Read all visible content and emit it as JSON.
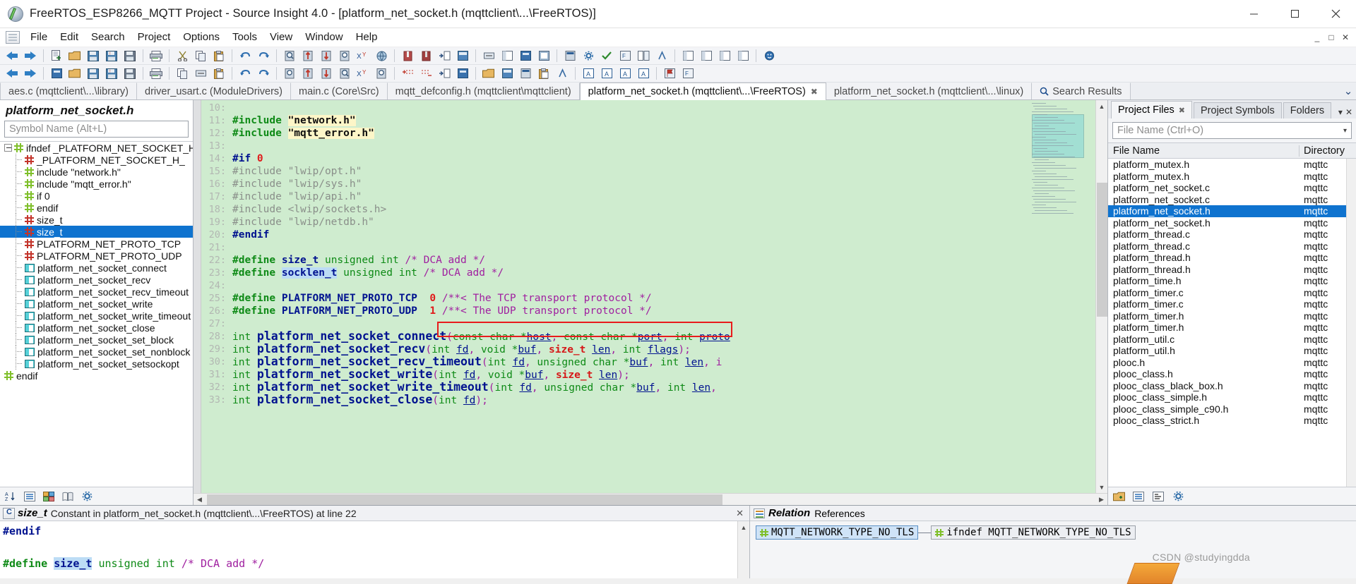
{
  "window": {
    "title": "FreeRTOS_ESP8266_MQTT Project - Source Insight 4.0 - [platform_net_socket.h (mqttclient\\...\\FreeRTOS)]",
    "app_icon": "source-insight-icon",
    "minimize": "minimize-icon",
    "maximize": "maximize-icon",
    "close": "close-icon"
  },
  "menu": {
    "items": [
      "File",
      "Edit",
      "Search",
      "Project",
      "Options",
      "Tools",
      "View",
      "Window",
      "Help"
    ],
    "doc_icon": "document-icon",
    "mdi_controls": [
      "_",
      "□",
      "✕"
    ]
  },
  "doc_tabs": [
    {
      "label": "aes.c (mqttclient\\...\\library)",
      "active": false,
      "closable": false,
      "icon": ""
    },
    {
      "label": "driver_usart.c (ModuleDrivers)",
      "active": false,
      "closable": false,
      "icon": ""
    },
    {
      "label": "main.c (Core\\Src)",
      "active": false,
      "closable": false,
      "icon": ""
    },
    {
      "label": "mqtt_defconfig.h (mqttclient\\mqttclient)",
      "active": false,
      "closable": false,
      "icon": ""
    },
    {
      "label": "platform_net_socket.h (mqttclient\\...\\FreeRTOS)",
      "active": true,
      "closable": true,
      "icon": ""
    },
    {
      "label": "platform_net_socket.h (mqttclient\\...\\linux)",
      "active": false,
      "closable": false,
      "icon": ""
    },
    {
      "label": "Search Results",
      "active": false,
      "closable": false,
      "icon": "search-icon"
    }
  ],
  "symbol_panel": {
    "title": "platform_net_socket.h",
    "search_placeholder": "Symbol Name (Alt+L)",
    "search_value": "",
    "tree": [
      {
        "label": "ifndef _PLATFORM_NET_SOCKET_H_",
        "icon": "hash-green",
        "depth": 0,
        "root": true,
        "selected": false
      },
      {
        "label": "_PLATFORM_NET_SOCKET_H_",
        "icon": "hash-red",
        "depth": 1,
        "selected": false
      },
      {
        "label": "include \"network.h\"",
        "icon": "hash-green",
        "depth": 1,
        "selected": false
      },
      {
        "label": "include \"mqtt_error.h\"",
        "icon": "hash-green",
        "depth": 1,
        "selected": false
      },
      {
        "label": "if 0",
        "icon": "hash-green",
        "depth": 1,
        "selected": false
      },
      {
        "label": "endif",
        "icon": "hash-green",
        "depth": 1,
        "selected": false
      },
      {
        "label": "size_t",
        "icon": "hash-red",
        "depth": 1,
        "selected": false
      },
      {
        "label": "size_t",
        "icon": "hash-red",
        "depth": 1,
        "selected": true
      },
      {
        "label": "PLATFORM_NET_PROTO_TCP",
        "icon": "hash-red",
        "depth": 1,
        "selected": false
      },
      {
        "label": "PLATFORM_NET_PROTO_UDP",
        "icon": "hash-red",
        "depth": 1,
        "selected": false
      },
      {
        "label": "platform_net_socket_connect",
        "icon": "function",
        "depth": 1,
        "selected": false
      },
      {
        "label": "platform_net_socket_recv",
        "icon": "function",
        "depth": 1,
        "selected": false
      },
      {
        "label": "platform_net_socket_recv_timeout",
        "icon": "function",
        "depth": 1,
        "selected": false
      },
      {
        "label": "platform_net_socket_write",
        "icon": "function",
        "depth": 1,
        "selected": false
      },
      {
        "label": "platform_net_socket_write_timeout",
        "icon": "function",
        "depth": 1,
        "selected": false
      },
      {
        "label": "platform_net_socket_close",
        "icon": "function",
        "depth": 1,
        "selected": false
      },
      {
        "label": "platform_net_socket_set_block",
        "icon": "function",
        "depth": 1,
        "selected": false
      },
      {
        "label": "platform_net_socket_set_nonblock",
        "icon": "function",
        "depth": 1,
        "selected": false
      },
      {
        "label": "platform_net_socket_setsockopt",
        "icon": "function",
        "depth": 1,
        "selected": false
      },
      {
        "label": "endif",
        "icon": "hash-green",
        "depth": 0,
        "selected": false
      }
    ],
    "bottom_icons": [
      "sort-az-icon",
      "list-icon",
      "group-icon",
      "book-icon",
      "settings-icon"
    ]
  },
  "editor": {
    "highlight_box_line": 23,
    "lines": [
      {
        "n": "10",
        "parts": []
      },
      {
        "n": "11",
        "parts": [
          {
            "t": "#include ",
            "c": "k-pre"
          },
          {
            "t": "\"network.h\"",
            "c": "k-str"
          }
        ]
      },
      {
        "n": "12",
        "parts": [
          {
            "t": "#include ",
            "c": "k-pre"
          },
          {
            "t": "\"mqtt_error.h\"",
            "c": "k-str"
          }
        ]
      },
      {
        "n": "13",
        "parts": []
      },
      {
        "n": "14",
        "parts": [
          {
            "t": "#if ",
            "c": "k-dir"
          },
          {
            "t": "0",
            "c": "k-num"
          }
        ]
      },
      {
        "n": "15",
        "parts": [
          {
            "t": "#include \"lwip/opt.h\"",
            "c": "k-grey"
          }
        ]
      },
      {
        "n": "16",
        "parts": [
          {
            "t": "#include \"lwip/sys.h\"",
            "c": "k-grey"
          }
        ]
      },
      {
        "n": "17",
        "parts": [
          {
            "t": "#include \"lwip/api.h\"",
            "c": "k-grey"
          }
        ]
      },
      {
        "n": "18",
        "parts": [
          {
            "t": "#include <lwip/sockets.h>",
            "c": "k-grey"
          }
        ]
      },
      {
        "n": "19",
        "parts": [
          {
            "t": "#include \"lwip/netdb.h\"",
            "c": "k-grey"
          }
        ]
      },
      {
        "n": "20",
        "parts": [
          {
            "t": "#endif",
            "c": "k-dir"
          }
        ]
      },
      {
        "n": "21",
        "parts": []
      },
      {
        "n": "22",
        "parts": [
          {
            "t": "#define ",
            "c": "k-pre"
          },
          {
            "t": "size_t",
            "c": "k-def"
          },
          {
            "t": " unsigned int ",
            "c": "k-int"
          },
          {
            "t": "/* DCA add */",
            "c": "k-cmt"
          }
        ]
      },
      {
        "n": "23",
        "parts": [
          {
            "t": "#define ",
            "c": "k-pre"
          },
          {
            "t": "socklen_t",
            "c": "k-def hl-sel"
          },
          {
            "t": " unsigned int ",
            "c": "k-int"
          },
          {
            "t": "/* DCA add */",
            "c": "k-cmt"
          }
        ]
      },
      {
        "n": "24",
        "parts": []
      },
      {
        "n": "25",
        "parts": [
          {
            "t": "#define ",
            "c": "k-pre"
          },
          {
            "t": "PLATFORM_NET_PROTO_TCP  ",
            "c": "k-def"
          },
          {
            "t": "0 ",
            "c": "k-num"
          },
          {
            "t": "/**< The TCP transport protocol */",
            "c": "k-cmt"
          }
        ]
      },
      {
        "n": "26",
        "parts": [
          {
            "t": "#define ",
            "c": "k-pre"
          },
          {
            "t": "PLATFORM_NET_PROTO_UDP  ",
            "c": "k-def"
          },
          {
            "t": "1 ",
            "c": "k-num"
          },
          {
            "t": "/**< The UDP transport protocol */",
            "c": "k-cmt"
          }
        ]
      },
      {
        "n": "27",
        "parts": []
      },
      {
        "n": "28",
        "parts": [
          {
            "t": "int ",
            "c": "k-type"
          },
          {
            "t": "platform_net_socket_connect",
            "c": "k-fn"
          },
          {
            "t": "(",
            "c": "k-paren"
          },
          {
            "t": "const char *",
            "c": "k-int"
          },
          {
            "t": "host",
            "c": "k-var"
          },
          {
            "t": ", ",
            "c": "k-paren"
          },
          {
            "t": "const char *",
            "c": "k-int"
          },
          {
            "t": "port",
            "c": "k-var"
          },
          {
            "t": ", ",
            "c": "k-paren"
          },
          {
            "t": "int ",
            "c": "k-int"
          },
          {
            "t": "proto",
            "c": "k-var"
          }
        ]
      },
      {
        "n": "29",
        "parts": [
          {
            "t": "int ",
            "c": "k-type"
          },
          {
            "t": "platform_net_socket_recv",
            "c": "k-fn"
          },
          {
            "t": "(",
            "c": "k-paren"
          },
          {
            "t": "int ",
            "c": "k-int"
          },
          {
            "t": "fd",
            "c": "k-var"
          },
          {
            "t": ", ",
            "c": "k-paren"
          },
          {
            "t": "void *",
            "c": "k-int"
          },
          {
            "t": "buf",
            "c": "k-var"
          },
          {
            "t": ", ",
            "c": "k-paren"
          },
          {
            "t": "size_t ",
            "c": "k-sizet"
          },
          {
            "t": "len",
            "c": "k-var"
          },
          {
            "t": ", ",
            "c": "k-paren"
          },
          {
            "t": "int ",
            "c": "k-int"
          },
          {
            "t": "flags",
            "c": "k-var"
          },
          {
            "t": ");",
            "c": "k-paren"
          }
        ]
      },
      {
        "n": "30",
        "parts": [
          {
            "t": "int ",
            "c": "k-type"
          },
          {
            "t": "platform_net_socket_recv_timeout",
            "c": "k-fn"
          },
          {
            "t": "(",
            "c": "k-paren"
          },
          {
            "t": "int ",
            "c": "k-int"
          },
          {
            "t": "fd",
            "c": "k-var"
          },
          {
            "t": ", ",
            "c": "k-paren"
          },
          {
            "t": "unsigned char *",
            "c": "k-int"
          },
          {
            "t": "buf",
            "c": "k-var"
          },
          {
            "t": ", ",
            "c": "k-paren"
          },
          {
            "t": "int ",
            "c": "k-int"
          },
          {
            "t": "len",
            "c": "k-var"
          },
          {
            "t": ", i",
            "c": "k-paren"
          }
        ]
      },
      {
        "n": "31",
        "parts": [
          {
            "t": "int ",
            "c": "k-type"
          },
          {
            "t": "platform_net_socket_write",
            "c": "k-fn"
          },
          {
            "t": "(",
            "c": "k-paren"
          },
          {
            "t": "int ",
            "c": "k-int"
          },
          {
            "t": "fd",
            "c": "k-var"
          },
          {
            "t": ", ",
            "c": "k-paren"
          },
          {
            "t": "void *",
            "c": "k-int"
          },
          {
            "t": "buf",
            "c": "k-var"
          },
          {
            "t": ", ",
            "c": "k-paren"
          },
          {
            "t": "size_t ",
            "c": "k-sizet"
          },
          {
            "t": "len",
            "c": "k-var"
          },
          {
            "t": ");",
            "c": "k-paren"
          }
        ]
      },
      {
        "n": "32",
        "parts": [
          {
            "t": "int ",
            "c": "k-type"
          },
          {
            "t": "platform_net_socket_write_timeout",
            "c": "k-fn"
          },
          {
            "t": "(",
            "c": "k-paren"
          },
          {
            "t": "int ",
            "c": "k-int"
          },
          {
            "t": "fd",
            "c": "k-var"
          },
          {
            "t": ", ",
            "c": "k-paren"
          },
          {
            "t": "unsigned char *",
            "c": "k-int"
          },
          {
            "t": "buf",
            "c": "k-var"
          },
          {
            "t": ", ",
            "c": "k-paren"
          },
          {
            "t": "int ",
            "c": "k-int"
          },
          {
            "t": "len",
            "c": "k-var"
          },
          {
            "t": ",",
            "c": "k-paren"
          }
        ]
      },
      {
        "n": "33",
        "parts": [
          {
            "t": "int ",
            "c": "k-type"
          },
          {
            "t": "platform_net_socket_close",
            "c": "k-fn"
          },
          {
            "t": "(",
            "c": "k-paren"
          },
          {
            "t": "int ",
            "c": "k-int"
          },
          {
            "t": "fd",
            "c": "k-var"
          },
          {
            "t": ");",
            "c": "k-paren"
          }
        ]
      }
    ]
  },
  "project_panel": {
    "tabs": [
      {
        "label": "Project Files",
        "active": true,
        "closable": true
      },
      {
        "label": "Project Symbols",
        "active": false,
        "closable": false
      },
      {
        "label": "Folders",
        "active": false,
        "closable": false
      }
    ],
    "tab_controls": [
      "chevron-down-icon",
      "close-icon"
    ],
    "search_placeholder": "File Name (Ctrl+O)",
    "search_value": "",
    "columns": [
      "File Name",
      "Directory"
    ],
    "rows": [
      {
        "name": "platform_mutex.h",
        "dir": "mqttc",
        "selected": false
      },
      {
        "name": "platform_mutex.h",
        "dir": "mqttc",
        "selected": false
      },
      {
        "name": "platform_net_socket.c",
        "dir": "mqttc",
        "selected": false
      },
      {
        "name": "platform_net_socket.c",
        "dir": "mqttc",
        "selected": false
      },
      {
        "name": "platform_net_socket.h",
        "dir": "mqttc",
        "selected": true
      },
      {
        "name": "platform_net_socket.h",
        "dir": "mqttc",
        "selected": false
      },
      {
        "name": "platform_thread.c",
        "dir": "mqttc",
        "selected": false
      },
      {
        "name": "platform_thread.c",
        "dir": "mqttc",
        "selected": false
      },
      {
        "name": "platform_thread.h",
        "dir": "mqttc",
        "selected": false
      },
      {
        "name": "platform_thread.h",
        "dir": "mqttc",
        "selected": false
      },
      {
        "name": "platform_time.h",
        "dir": "mqttc",
        "selected": false
      },
      {
        "name": "platform_timer.c",
        "dir": "mqttc",
        "selected": false
      },
      {
        "name": "platform_timer.c",
        "dir": "mqttc",
        "selected": false
      },
      {
        "name": "platform_timer.h",
        "dir": "mqttc",
        "selected": false
      },
      {
        "name": "platform_timer.h",
        "dir": "mqttc",
        "selected": false
      },
      {
        "name": "platform_util.c",
        "dir": "mqttc",
        "selected": false
      },
      {
        "name": "platform_util.h",
        "dir": "mqttc",
        "selected": false
      },
      {
        "name": "plooc.h",
        "dir": "mqttc",
        "selected": false
      },
      {
        "name": "plooc_class.h",
        "dir": "mqttc",
        "selected": false
      },
      {
        "name": "plooc_class_black_box.h",
        "dir": "mqttc",
        "selected": false
      },
      {
        "name": "plooc_class_simple.h",
        "dir": "mqttc",
        "selected": false
      },
      {
        "name": "plooc_class_simple_c90.h",
        "dir": "mqttc",
        "selected": false
      },
      {
        "name": "plooc_class_strict.h",
        "dir": "mqttc",
        "selected": false
      }
    ],
    "bottom_icons": [
      "add-file-icon",
      "list-icon",
      "properties-icon",
      "settings-icon"
    ]
  },
  "context_panel": {
    "symbol": "size_t",
    "meta": "Constant in platform_net_socket.h (mqttclient\\...\\FreeRTOS) at line 22",
    "close": "close-icon",
    "lines": [
      {
        "parts": [
          {
            "t": "#endif",
            "c": "k-dir"
          }
        ]
      },
      {
        "parts": []
      },
      {
        "parts": [
          {
            "t": "#define ",
            "c": "k-pre"
          },
          {
            "t": "size_t",
            "c": "k-def hl-sel"
          },
          {
            "t": " unsigned int ",
            "c": "k-int"
          },
          {
            "t": "/* DCA add */",
            "c": "k-cmt"
          }
        ]
      }
    ]
  },
  "relation_panel": {
    "title": "Relation",
    "subtitle": "References",
    "nodes": [
      {
        "label": "MQTT_NETWORK_TYPE_NO_TLS",
        "selected": true
      },
      {
        "label": "ifndef MQTT_NETWORK_TYPE_NO_TLS",
        "selected": false
      }
    ]
  },
  "watermark": "CSDN @studyingdda"
}
